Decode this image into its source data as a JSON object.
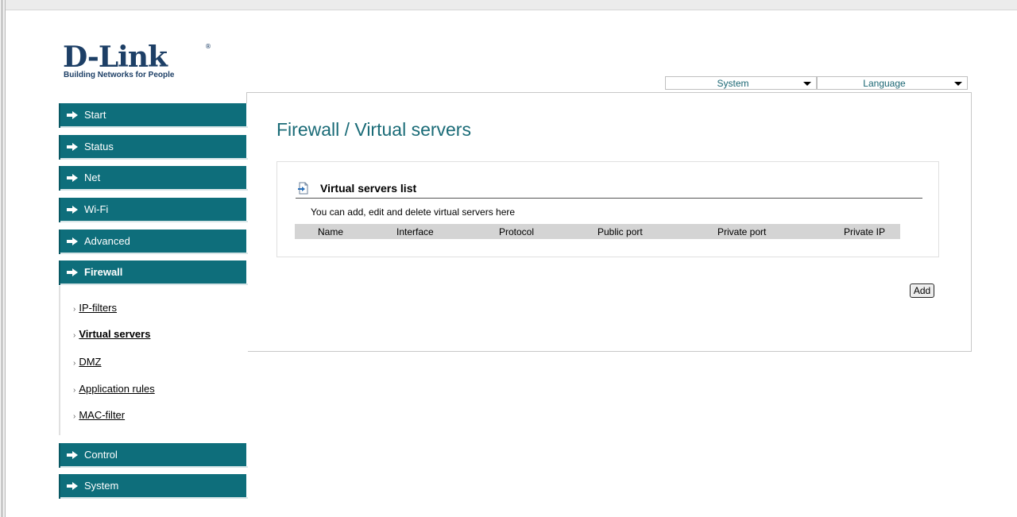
{
  "logo": {
    "main": "D-Link",
    "reg": "®",
    "tagline": "Building Networks for People"
  },
  "top_menu": {
    "system": {
      "value": "System",
      "icon": "chevron-down-icon"
    },
    "language": {
      "value": "Language",
      "icon": "chevron-down-icon"
    }
  },
  "sidebar": {
    "items": [
      {
        "label": "Start",
        "icon": "arrow-right-icon"
      },
      {
        "label": "Status",
        "icon": "arrow-right-icon"
      },
      {
        "label": "Net",
        "icon": "arrow-right-icon"
      },
      {
        "label": "Wi-Fi",
        "icon": "arrow-right-icon"
      },
      {
        "label": "Advanced",
        "icon": "arrow-right-icon"
      },
      {
        "label": "Firewall",
        "icon": "arrow-right-icon",
        "active": true
      },
      {
        "label": "Control",
        "icon": "arrow-right-icon"
      },
      {
        "label": "System",
        "icon": "arrow-right-icon"
      }
    ],
    "sub_items": [
      {
        "label": "IP-filters"
      },
      {
        "label": "Virtual servers",
        "active": true
      },
      {
        "label": "DMZ"
      },
      {
        "label": "Application rules"
      },
      {
        "label": "MAC-filter"
      }
    ],
    "bullet": "›"
  },
  "main": {
    "title": "Firewall / Virtual servers",
    "section_title": "Virtual servers list",
    "section_icon": "document-arrow-icon",
    "description": "You can add, edit and delete virtual servers here",
    "table": {
      "columns": [
        "Name",
        "Interface",
        "Protocol",
        "Public port",
        "Private port",
        "Private IP"
      ],
      "rows": []
    },
    "add_label": "Add"
  },
  "colors": {
    "accent": "#0e6e7b",
    "title": "#1a6b77",
    "header_bg": "#d4d4d4"
  }
}
